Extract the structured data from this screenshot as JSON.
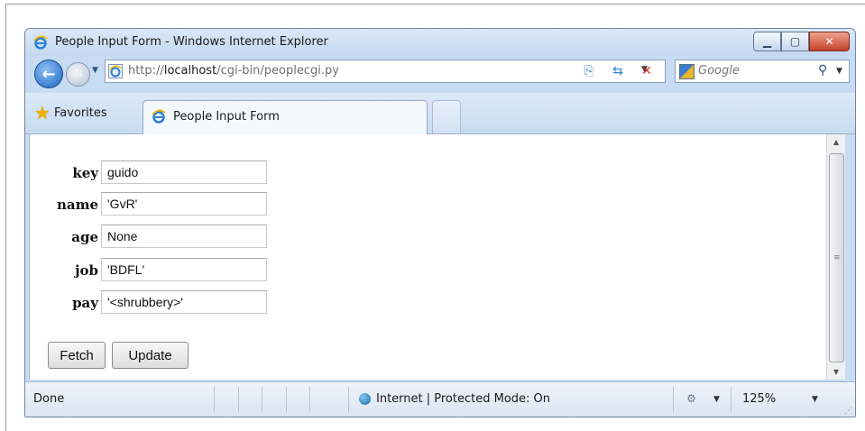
{
  "window": {
    "title": "People Input Form - Windows Internet Explorer"
  },
  "navigation": {
    "address": "http://localhost/cgi-bin/peoplecgi.py",
    "address_host": "localhost",
    "address_prefix": "http://",
    "address_suffix": "/cgi-bin/peoplecgi.py",
    "search_placeholder": "Google"
  },
  "tabs": {
    "favorites_label": "Favorites",
    "active_tab_label": "People Input Form"
  },
  "form": {
    "fields": [
      {
        "label": "key",
        "value": "guido"
      },
      {
        "label": "name",
        "value": "'GvR'"
      },
      {
        "label": "age",
        "value": "None"
      },
      {
        "label": "job",
        "value": "'BDFL'"
      },
      {
        "label": "pay",
        "value": "'<shrubbery>'"
      }
    ],
    "fetch_label": "Fetch",
    "update_label": "Update"
  },
  "status": {
    "text": "Done",
    "zone": "Internet | Protected Mode: On",
    "zoom": "125%"
  },
  "icons": [
    "ie-logo-icon",
    "back-arrow-icon",
    "forward-arrow-icon",
    "compatibility-icon",
    "refresh-icon",
    "stop-icon",
    "search-icon",
    "star-icon",
    "globe-icon",
    "zoom-icon"
  ]
}
